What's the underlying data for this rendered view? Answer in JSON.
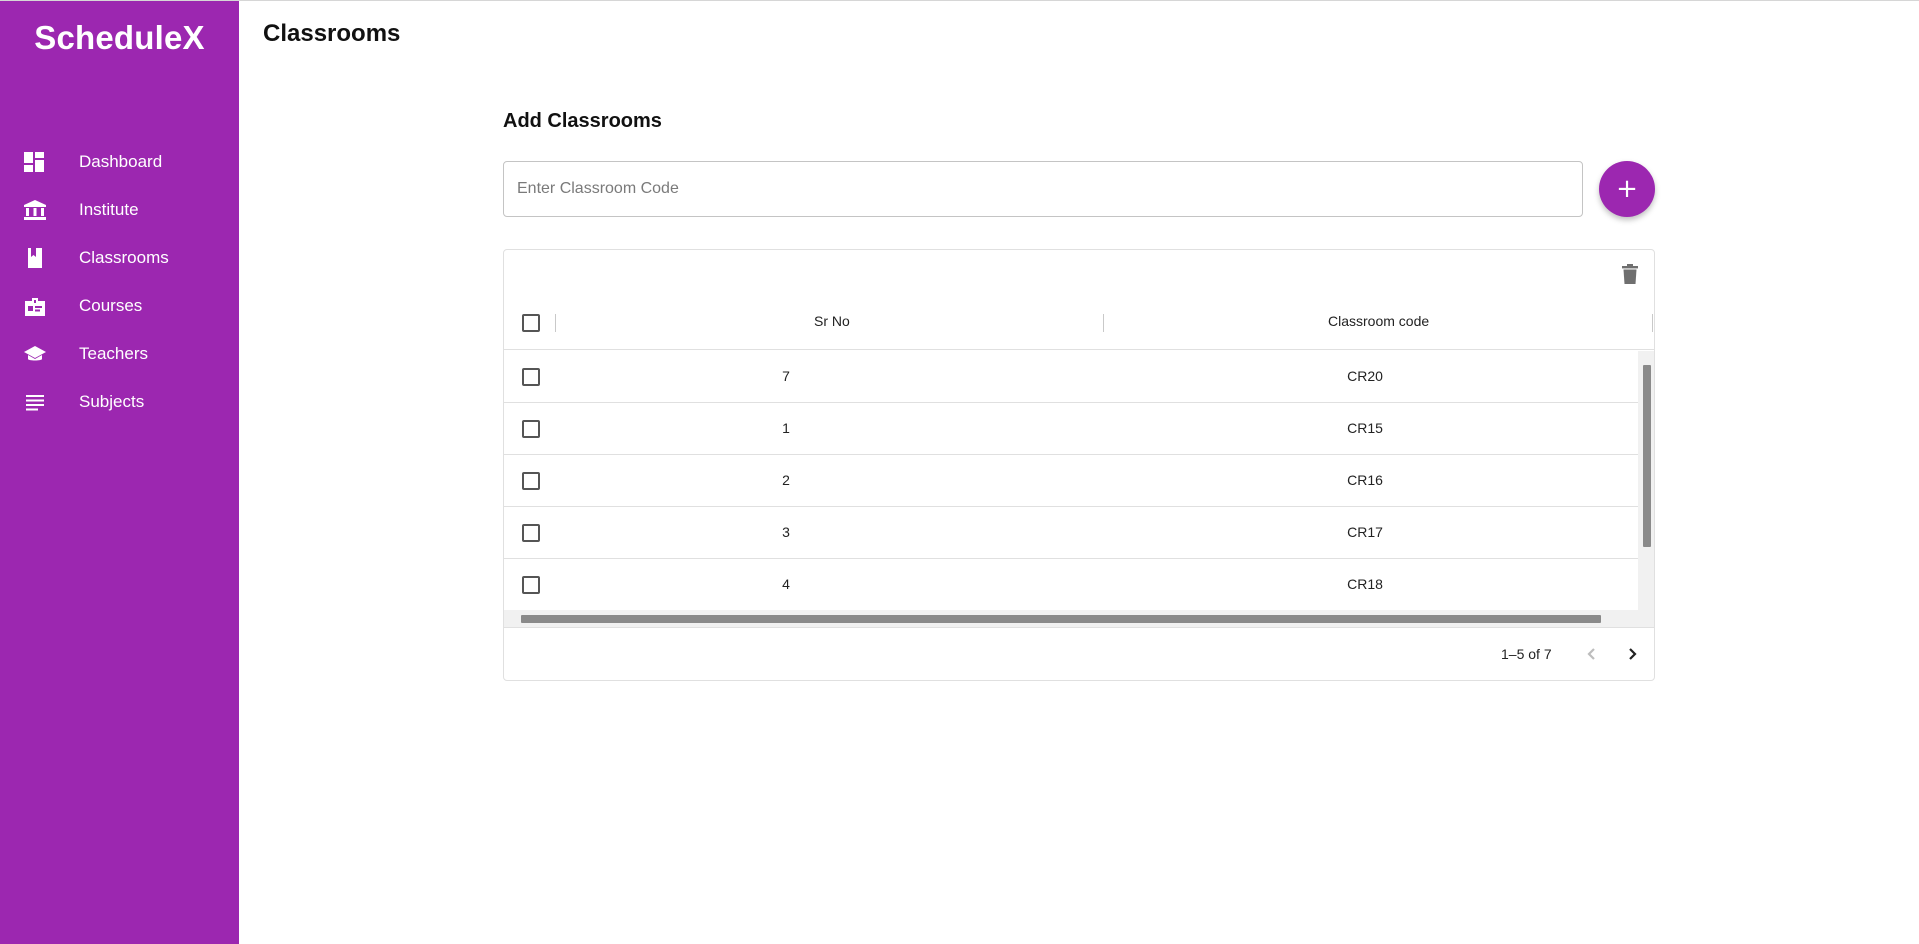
{
  "app": {
    "brand": "ScheduleX"
  },
  "colors": {
    "accent": "#9c27b0",
    "sidebar_text": "#ffffff"
  },
  "sidebar": {
    "items": [
      {
        "label": "Dashboard",
        "icon": "dashboard-icon"
      },
      {
        "label": "Institute",
        "icon": "institution-icon"
      },
      {
        "label": "Classrooms",
        "icon": "book-icon"
      },
      {
        "label": "Courses",
        "icon": "badge-icon"
      },
      {
        "label": "Teachers",
        "icon": "school-cap-icon"
      },
      {
        "label": "Subjects",
        "icon": "subject-lines-icon"
      }
    ]
  },
  "header": {
    "title": "Classrooms"
  },
  "form": {
    "section_title": "Add Classrooms",
    "input_placeholder": "Enter Classroom Code",
    "input_value": "",
    "add_button_label": "+"
  },
  "table": {
    "columns": [
      "Sr No",
      "Classroom code"
    ],
    "rows": [
      {
        "sr_no": "7",
        "code": "CR20"
      },
      {
        "sr_no": "1",
        "code": "CR15"
      },
      {
        "sr_no": "2",
        "code": "CR16"
      },
      {
        "sr_no": "3",
        "code": "CR17"
      },
      {
        "sr_no": "4",
        "code": "CR18"
      }
    ],
    "pagination": "1–5 of 7",
    "toolbar_icon": "trash-icon"
  }
}
